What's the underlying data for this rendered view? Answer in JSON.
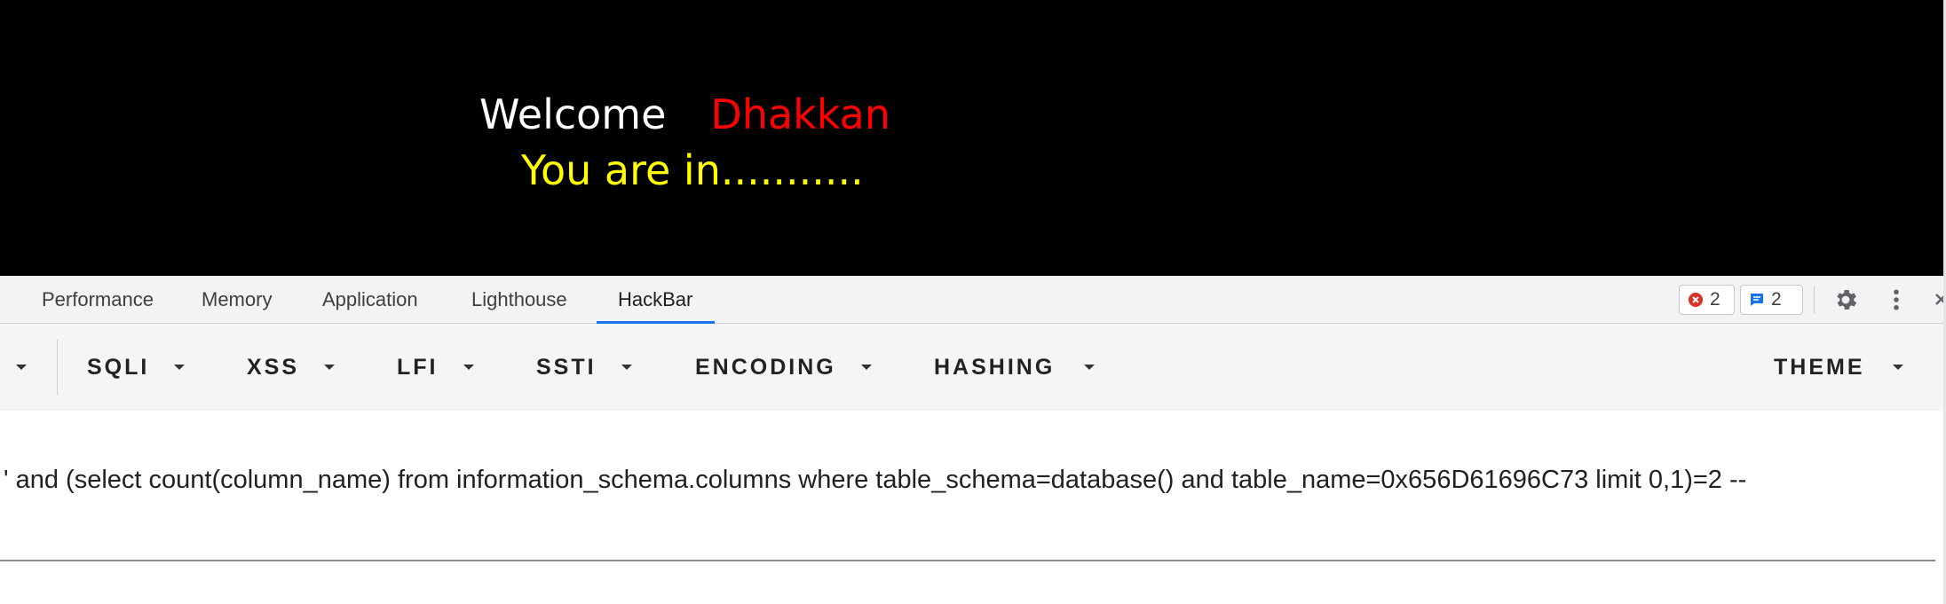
{
  "page": {
    "welcome_word": "Welcome",
    "welcome_name": "Dhakkan",
    "status_text": "You are in..........."
  },
  "devtools": {
    "tabs": [
      {
        "label": "Performance"
      },
      {
        "label": "Memory"
      },
      {
        "label": "Application"
      },
      {
        "label": "Lighthouse"
      },
      {
        "label": "HackBar",
        "active": true
      }
    ],
    "errors_count": "2",
    "messages_count": "2",
    "icons": {
      "errors": "error-circle-icon",
      "messages": "message-icon",
      "settings": "gear-icon",
      "more": "more-vertical-icon",
      "close": "close-icon"
    },
    "colors": {
      "active_tab": "#1a73e8",
      "error": "#d93025",
      "message": "#1a73e8"
    }
  },
  "hackbar": {
    "menus": [
      {
        "label": "SQLI"
      },
      {
        "label": "XSS"
      },
      {
        "label": "LFI"
      },
      {
        "label": "SSTI"
      },
      {
        "label": "ENCODING"
      },
      {
        "label": "HASHING"
      }
    ],
    "theme_label": "THEME",
    "url_value": "' and (select count(column_name) from information_schema.columns where table_schema=database() and table_name=0x656D61696C73 limit 0,1)=2 --"
  }
}
